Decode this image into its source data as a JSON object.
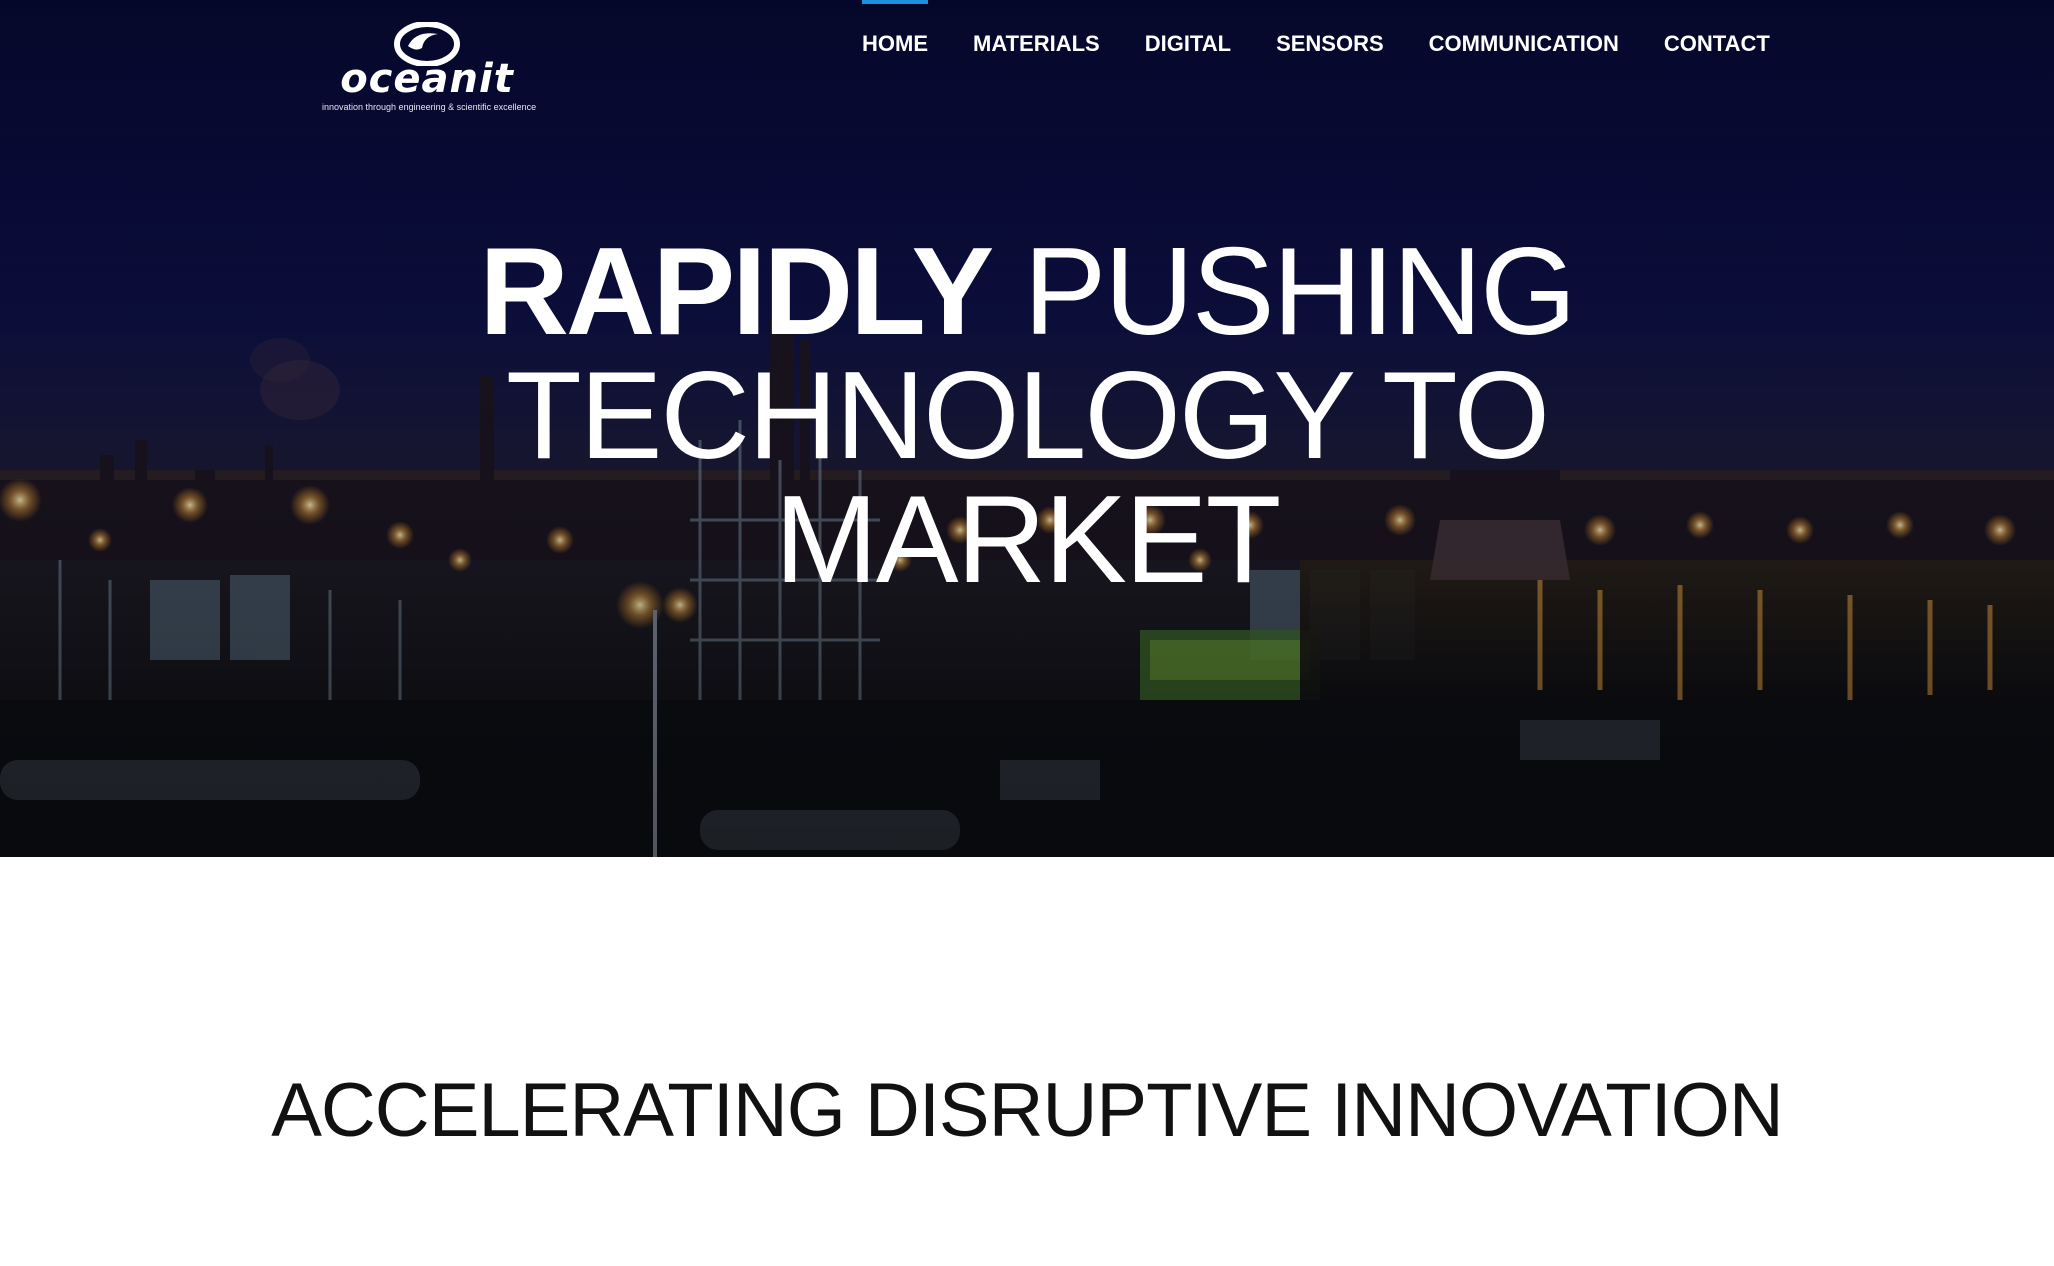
{
  "brand": {
    "name": "oceanit",
    "tagline": "innovation through engineering & scientific excellence",
    "logo_icon": "oceanit-swirl-logo"
  },
  "nav": {
    "items": [
      {
        "label": "HOME",
        "active": true
      },
      {
        "label": "MATERIALS",
        "active": false
      },
      {
        "label": "DIGITAL",
        "active": false
      },
      {
        "label": "SENSORS",
        "active": false
      },
      {
        "label": "COMMUNICATION",
        "active": false
      },
      {
        "label": "CONTACT",
        "active": false
      }
    ],
    "active_color": "#1e90e0"
  },
  "hero": {
    "headline_bold": "RAPIDLY",
    "headline_rest_line1": "PUSHING",
    "headline_line2": "TECHNOLOGY TO",
    "headline_line3": "MARKET",
    "background_image": "industrial-refinery-night-scene"
  },
  "section": {
    "title": "ACCELERATING DISRUPTIVE INNOVATION"
  }
}
